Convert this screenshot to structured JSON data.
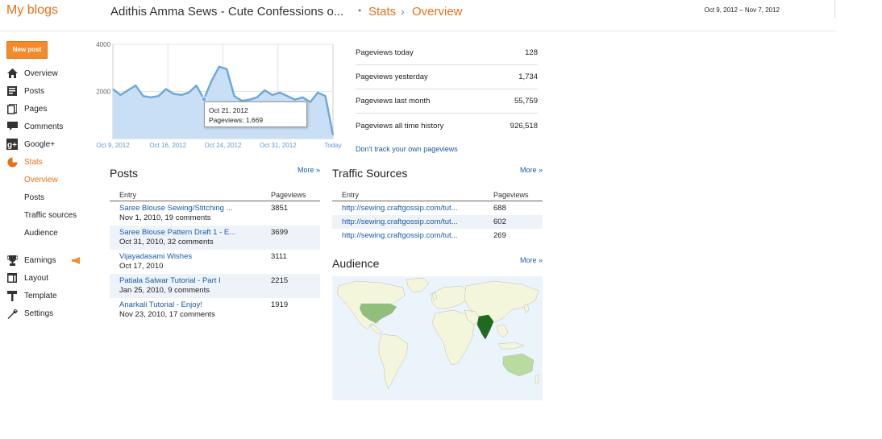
{
  "header": {
    "brand": "My blogs",
    "blog_title": "Adithis Amma Sews - Cute Confessions o...",
    "crumb_stats": "Stats",
    "crumb_sep": "›",
    "crumb_overview": "Overview",
    "date_range": "Oct 9, 2012 – Nov 7, 2012"
  },
  "new_post_label": "New post",
  "sidebar": {
    "items": [
      {
        "label": "Overview",
        "icon": "home-icon"
      },
      {
        "label": "Posts",
        "icon": "posts-icon"
      },
      {
        "label": "Pages",
        "icon": "pages-icon"
      },
      {
        "label": "Comments",
        "icon": "comments-icon"
      },
      {
        "label": "Google+",
        "icon": "google-plus-icon"
      },
      {
        "label": "Stats",
        "icon": "stats-icon"
      },
      {
        "label": "Earnings",
        "icon": "trophy-icon"
      },
      {
        "label": "Layout",
        "icon": "layout-icon"
      },
      {
        "label": "Template",
        "icon": "template-icon"
      },
      {
        "label": "Settings",
        "icon": "wrench-icon"
      }
    ],
    "stats_sub": [
      "Overview",
      "Posts",
      "Traffic sources",
      "Audience"
    ]
  },
  "chart_data": {
    "type": "area",
    "y_ticks": [
      "4000",
      "2000"
    ],
    "ylim": [
      0,
      4000
    ],
    "x_labels": [
      "Oct 9, 2012",
      "Oct 16, 2012",
      "Oct 24, 2012",
      "Oct 31, 2012",
      "Today"
    ],
    "series": [
      {
        "values": [
          2100,
          1850,
          2050,
          2250,
          1800,
          1750,
          1800,
          2100,
          1900,
          1850,
          1950,
          2250,
          1669,
          2450,
          3050,
          2950,
          1800,
          1600,
          1650,
          1750,
          2050,
          1850,
          1950,
          1800,
          1650,
          1750,
          1550,
          1950,
          1800,
          150
        ]
      }
    ],
    "color": "#6fa8dc",
    "fill": "#c9dff5"
  },
  "tooltip": {
    "date": "Oct 21, 2012",
    "value": "Pageviews: 1,669"
  },
  "stats": [
    {
      "label": "Pageviews today",
      "value": "128"
    },
    {
      "label": "Pageviews yesterday",
      "value": "1,734"
    },
    {
      "label": "Pageviews last month",
      "value": "55,759"
    },
    {
      "label": "Pageviews all time history",
      "value": "926,518"
    }
  ],
  "dont_track": "Don't track your own pageviews",
  "posts": {
    "title": "Posts",
    "more": "More »",
    "col_entry": "Entry",
    "col_pageviews": "Pageviews",
    "rows": [
      {
        "title": "Saree Blouse Sewing/Stitching ...",
        "sub": "Nov 1, 2010, 19 comments",
        "views": "3851"
      },
      {
        "title": "Saree Blouse Pattern Draft 1 - E...",
        "sub": "Oct 31, 2010, 32 comments",
        "views": "3699"
      },
      {
        "title": "Vijayadasami Wishes",
        "sub": "Oct 17, 2010",
        "views": "3111"
      },
      {
        "title": "Patiala Salwar Tutorial - Part I",
        "sub": "Jan 25, 2010, 9 comments",
        "views": "2215"
      },
      {
        "title": "Anarkali Tutorial - Enjoy!",
        "sub": "Nov 23, 2010, 17 comments",
        "views": "1919"
      }
    ]
  },
  "traffic": {
    "title": "Traffic Sources",
    "more": "More »",
    "col_entry": "Entry",
    "col_pageviews": "Pageviews",
    "rows": [
      {
        "url": "http://sewing.craftgossip.com/tut...",
        "views": "688"
      },
      {
        "url": "http://sewing.craftgossip.com/tut...",
        "views": "602"
      },
      {
        "url": "http://sewing.craftgossip.com/tut...",
        "views": "269"
      }
    ]
  },
  "audience": {
    "title": "Audience",
    "more": "More »"
  }
}
